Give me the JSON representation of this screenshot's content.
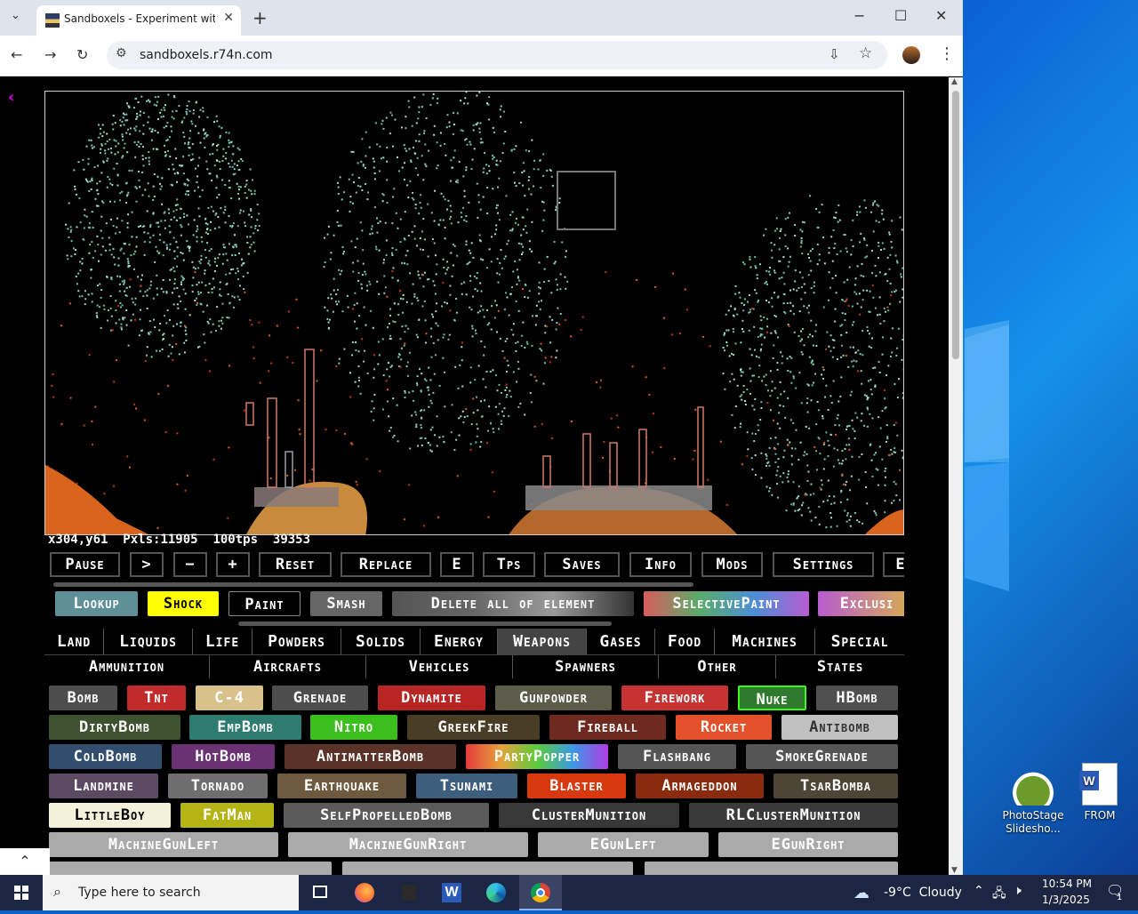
{
  "browser": {
    "tab_title": "Sandboxels - Experiment with P",
    "url": "sandboxels.r74n.com"
  },
  "game": {
    "stats": {
      "coords": "x304,y61",
      "pixels": "Pxls:11905",
      "tps": "100tps",
      "ticks": "39353"
    },
    "controls": [
      "Pause",
      ">",
      "−",
      "+",
      "Reset",
      "Replace",
      "E",
      "Tps",
      "Saves",
      "Info",
      "Mods",
      "Settings",
      "E"
    ],
    "tools": [
      "Lookup",
      "Shock",
      "Paint",
      "Smash",
      "Delete all of element",
      "SelectivePaint",
      "Exclusi"
    ],
    "categories": [
      "Land",
      "Liquids",
      "Life",
      "Powders",
      "Solids",
      "Energy",
      "Weapons",
      "Gases",
      "Food",
      "Machines",
      "Special"
    ],
    "active_category": "Weapons",
    "subcategories": [
      "Ammunition",
      "Aircrafts",
      "Vehicles",
      "Spawners",
      "Other",
      "States"
    ],
    "elements": [
      [
        "Bomb",
        "Tnt",
        "C-4",
        "Grenade",
        "Dynamite",
        "Gunpowder",
        "Firework",
        "Nuke",
        "HBomb"
      ],
      [
        "DirtyBomb",
        "EmpBomb",
        "Nitro",
        "GreekFire",
        "Fireball",
        "Rocket",
        "Antibomb"
      ],
      [
        "ColdBomb",
        "HotBomb",
        "AntimatterBomb",
        "PartyPopper",
        "Flashbang",
        "SmokeGrenade"
      ],
      [
        "Landmine",
        "Tornado",
        "Earthquake",
        "Tsunami",
        "Blaster",
        "Armageddon",
        "TsarBomba"
      ],
      [
        "LittleBoy",
        "FatMan",
        "SelfPropelledBomb",
        "ClusterMunition",
        "RLClusterMunition"
      ],
      [
        "MachineGunLeft",
        "MachineGunRight",
        "EGunLeft",
        "EGunRight"
      ]
    ]
  },
  "desktop": {
    "icons": [
      "PhotoStage Slidesho...",
      "FROM"
    ]
  },
  "taskbar": {
    "search_placeholder": "Type here to search",
    "weather": "-9°C  Cloudy",
    "time": "10:54 PM",
    "date": "1/3/2025",
    "notifications": "1"
  }
}
